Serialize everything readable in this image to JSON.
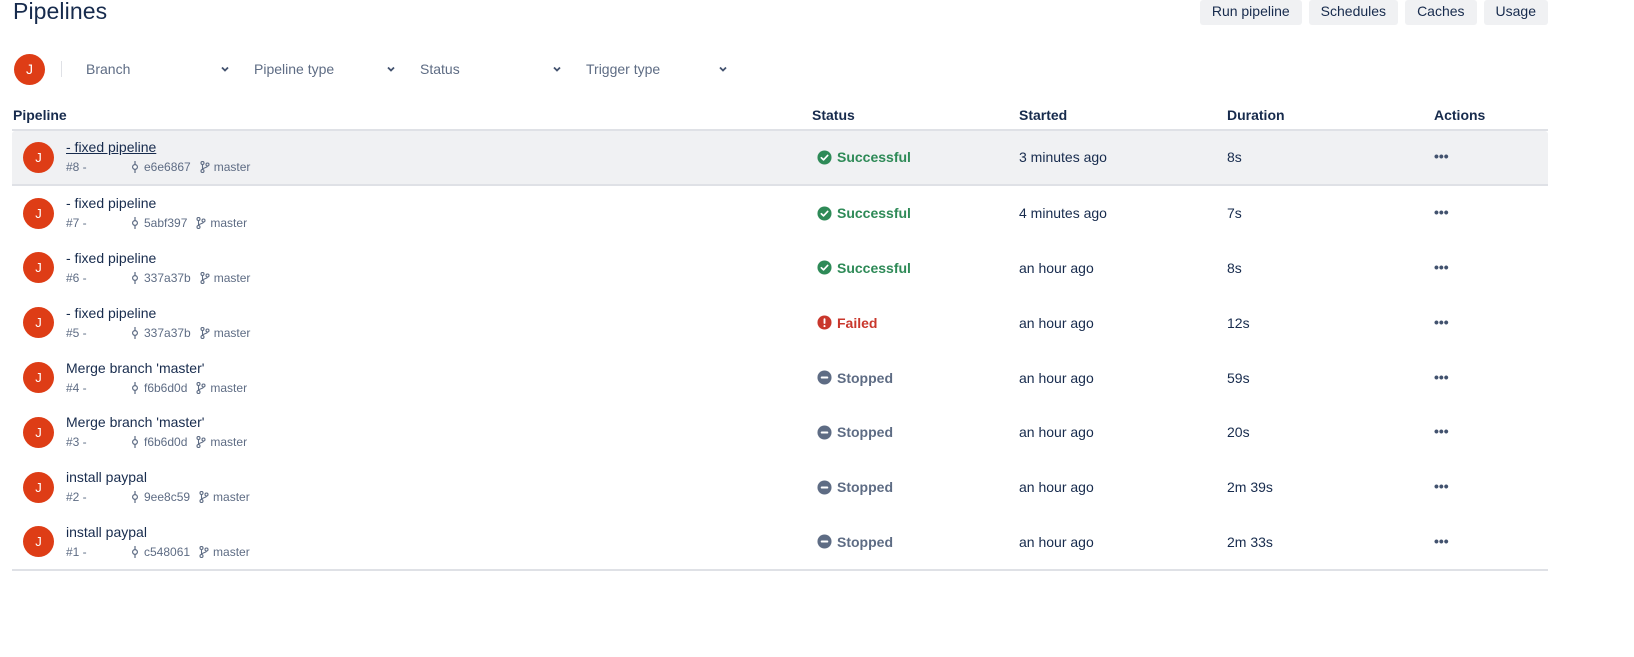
{
  "page": {
    "title": "Pipelines"
  },
  "toolbar": {
    "buttons": [
      {
        "label": "Run pipeline"
      },
      {
        "label": "Schedules"
      },
      {
        "label": "Caches"
      },
      {
        "label": "Usage"
      }
    ]
  },
  "filters": {
    "avatar_initial": "J",
    "branch": "Branch",
    "pipeline_type": "Pipeline type",
    "status": "Status",
    "trigger_type": "Trigger type"
  },
  "table": {
    "headers": {
      "pipeline": "Pipeline",
      "status": "Status",
      "started": "Started",
      "duration": "Duration",
      "actions": "Actions"
    },
    "actions_glyph": "•••",
    "rows": [
      {
        "avatar": "J",
        "title": "- fixed pipeline",
        "number": "#8 -",
        "commit": "e6e6867",
        "branch": "master",
        "status": "Successful",
        "status_type": "success",
        "started": "3 minutes ago",
        "duration": "8s",
        "hover": true
      },
      {
        "avatar": "J",
        "title": "- fixed pipeline",
        "number": "#7 -",
        "commit": "5abf397",
        "branch": "master",
        "status": "Successful",
        "status_type": "success",
        "started": "4 minutes ago",
        "duration": "7s"
      },
      {
        "avatar": "J",
        "title": "- fixed pipeline",
        "number": "#6 -",
        "commit": "337a37b",
        "branch": "master",
        "status": "Successful",
        "status_type": "success",
        "started": "an hour ago",
        "duration": "8s"
      },
      {
        "avatar": "J",
        "title": "- fixed pipeline",
        "number": "#5 -",
        "commit": "337a37b",
        "branch": "master",
        "status": "Failed",
        "status_type": "failed",
        "started": "an hour ago",
        "duration": "12s"
      },
      {
        "avatar": "J",
        "title": "Merge branch 'master'",
        "number": "#4 -",
        "commit": "f6b6d0d",
        "branch": "master",
        "status": "Stopped",
        "status_type": "stopped",
        "started": "an hour ago",
        "duration": "59s"
      },
      {
        "avatar": "J",
        "title": "Merge branch 'master'",
        "number": "#3 -",
        "commit": "f6b6d0d",
        "branch": "master",
        "status": "Stopped",
        "status_type": "stopped",
        "started": "an hour ago",
        "duration": "20s"
      },
      {
        "avatar": "J",
        "title": "install paypal",
        "number": "#2 -",
        "commit": "9ee8c59",
        "branch": "master",
        "status": "Stopped",
        "status_type": "stopped",
        "started": "an hour ago",
        "duration": "2m 39s"
      },
      {
        "avatar": "J",
        "title": "install paypal",
        "number": "#1 -",
        "commit": "c548061",
        "branch": "master",
        "status": "Stopped",
        "status_type": "stopped",
        "started": "an hour ago",
        "duration": "2m 33s"
      }
    ]
  },
  "colors": {
    "avatar": "#de3d16",
    "success": "#2e8a57",
    "failed": "#c9372c",
    "stopped": "#5e6c84"
  }
}
